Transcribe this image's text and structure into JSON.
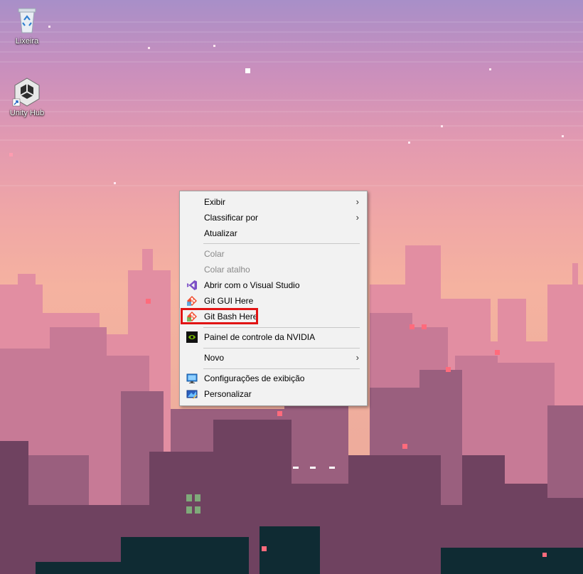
{
  "desktop": {
    "icons": [
      {
        "label": "Lixeira",
        "icon": "recycle-bin-icon"
      },
      {
        "label": "Unity Hub",
        "icon": "unity-hub-icon"
      }
    ]
  },
  "context_menu": {
    "items": [
      {
        "label": "Exibir",
        "submenu": true
      },
      {
        "label": "Classificar por",
        "submenu": true
      },
      {
        "label": "Atualizar"
      },
      {
        "label": "Colar",
        "disabled": true
      },
      {
        "label": "Colar atalho",
        "disabled": true
      },
      {
        "label": "Abrir com o Visual Studio",
        "icon": "visual-studio-icon"
      },
      {
        "label": "Git GUI Here",
        "icon": "git-icon"
      },
      {
        "label": "Git Bash Here",
        "icon": "git-icon",
        "highlighted": true
      },
      {
        "label": "Painel de controle da NVIDIA",
        "icon": "nvidia-icon"
      },
      {
        "label": "Novo",
        "submenu": true
      },
      {
        "label": "Configurações de exibição",
        "icon": "display-icon"
      },
      {
        "label": "Personalizar",
        "icon": "personalize-icon"
      }
    ],
    "submenu_arrow": "›"
  },
  "colors": {
    "highlight_border": "#e11414",
    "menu_background": "#f2f2f2"
  }
}
